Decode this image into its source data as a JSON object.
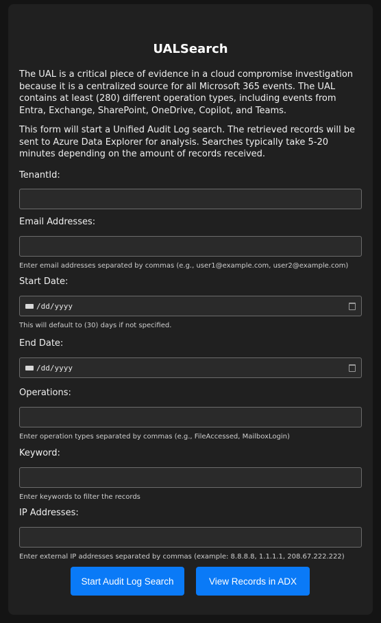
{
  "page": {
    "title": "UALSearch",
    "intro_1": "The UAL is a critical piece of evidence in a cloud compromise investigation because it is a centralized source for all Microsoft 365 events. The UAL contains at least (280) different operation types, including events from Entra, Exchange, SharePoint, OneDrive, Copilot, and Teams.",
    "intro_2": "This form will start a Unified Audit Log search. The retrieved records will be sent to Azure Data Explorer for analysis. Searches typically take 5-20 minutes depending on the amount of records received."
  },
  "form": {
    "tenant": {
      "label": "TenantId:",
      "value": ""
    },
    "emails": {
      "label": "Email Addresses:",
      "value": "",
      "help": "Enter email addresses separated by commas (e.g., user1@example.com, user2@example.com)"
    },
    "start_date": {
      "label": "Start Date:",
      "placeholder": "/dd/yyyy",
      "help": "This will default to (30) days if not specified."
    },
    "end_date": {
      "label": "End Date:",
      "placeholder": "/dd/yyyy"
    },
    "operations": {
      "label": "Operations:",
      "value": "",
      "help": "Enter operation types separated by commas (e.g., FileAccessed, MailboxLogin)"
    },
    "keyword": {
      "label": "Keyword:",
      "value": "",
      "help": "Enter keywords to filter the records"
    },
    "ip": {
      "label": "IP Addresses:",
      "value": "",
      "help": "Enter external IP addresses separated by commas (example: 8.8.8.8, 1.1.1.1, 208.67.222.222)"
    }
  },
  "buttons": {
    "start": "Start Audit Log Search",
    "view": "View Records in ADX"
  },
  "colors": {
    "background": "#141414",
    "card": "#202020",
    "input_bg": "#2a2a2a",
    "input_border": "#6c6c6c",
    "button": "#0a7af7"
  },
  "icons": {
    "calendar": "calendar-icon"
  }
}
